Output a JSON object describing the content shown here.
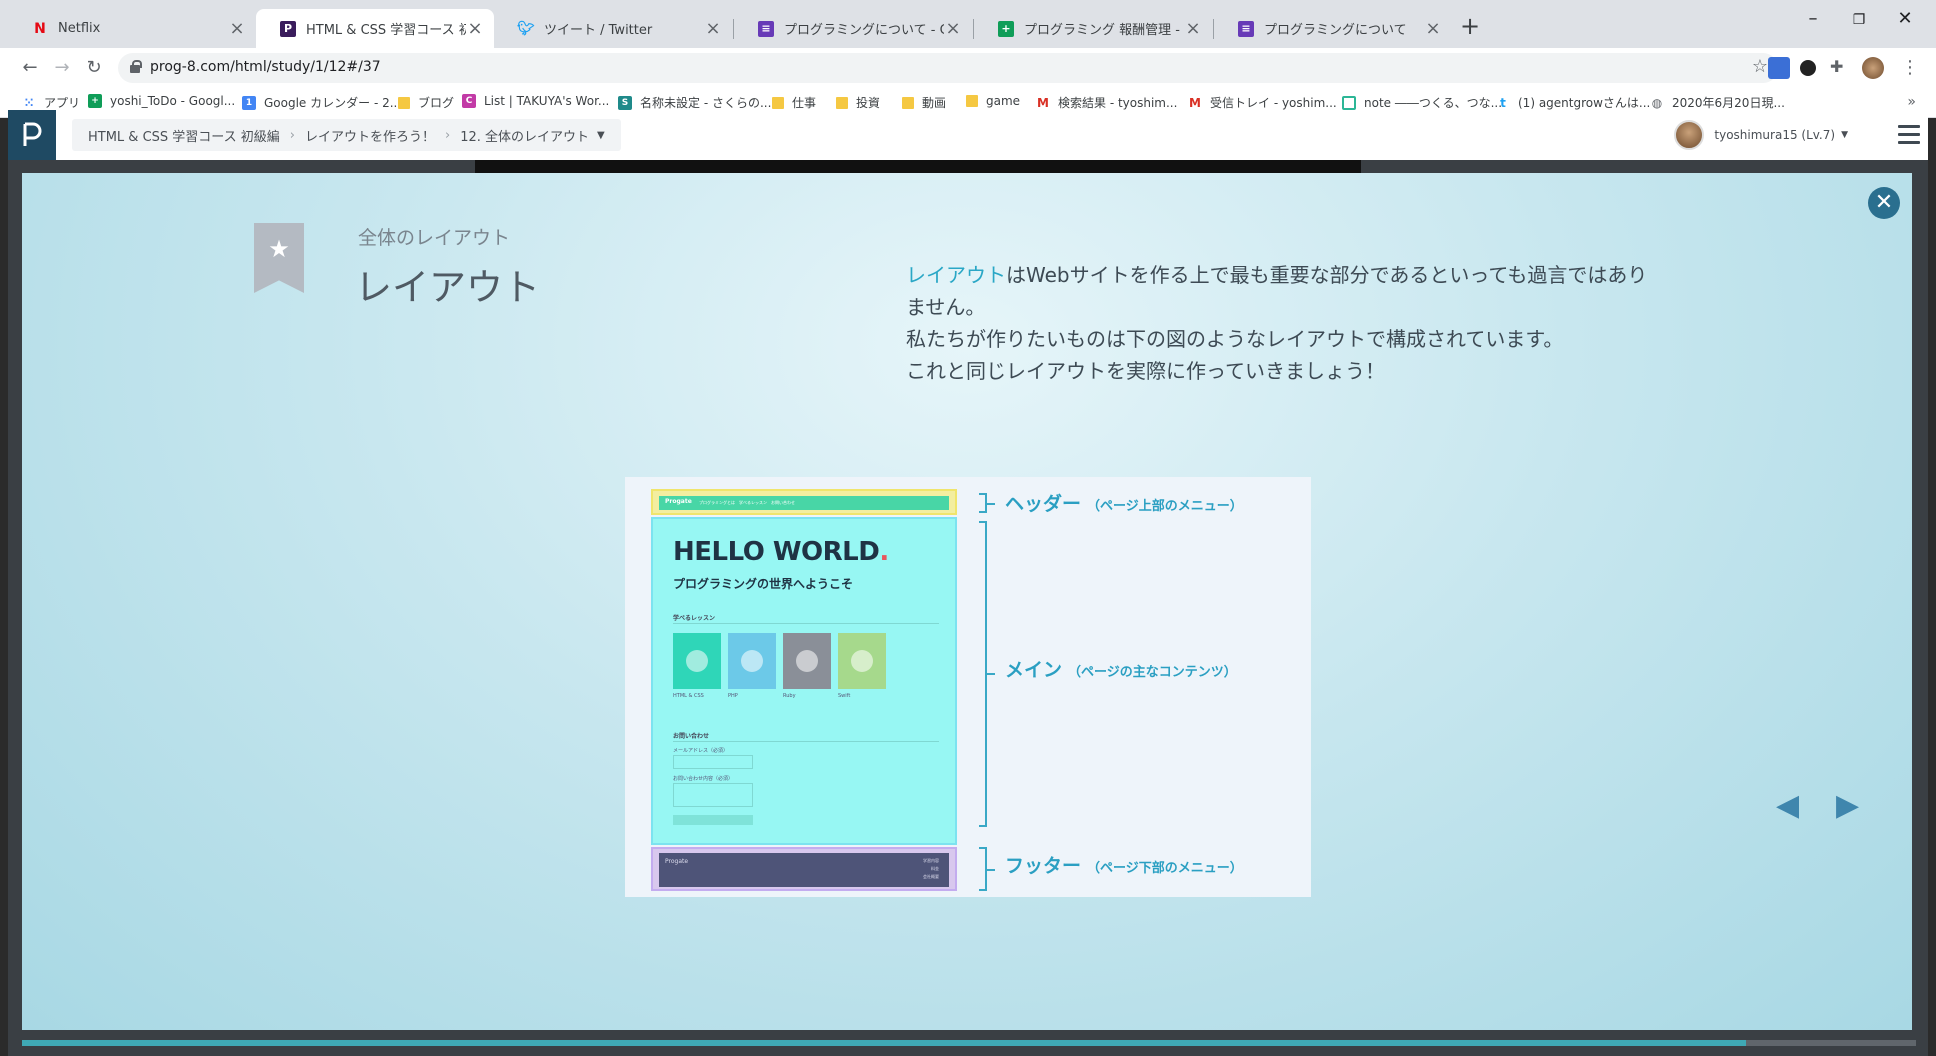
{
  "browser": {
    "tabs": [
      {
        "title": "Netflix",
        "fav": "N",
        "fav_color": "#e50914",
        "active": false
      },
      {
        "title": "HTML & CSS 学習コース 初級編 | ",
        "fav": "P",
        "fav_color": "#3a1c5c",
        "active": true
      },
      {
        "title": "ツイート / Twitter",
        "fav": "t",
        "fav_color": "#1da1f2",
        "active": false
      },
      {
        "title": "プログラミングについて - Google フォ",
        "fav": "≡",
        "fav_color": "#673ab7",
        "active": false
      },
      {
        "title": "プログラミング 報酬管理 - Google ス",
        "fav": "+",
        "fav_color": "#0f9d58",
        "active": false
      },
      {
        "title": "プログラミングについて",
        "fav": "≡",
        "fav_color": "#673ab7",
        "active": false
      }
    ],
    "url": "prog-8.com/html/study/1/12#/37",
    "bookmarks": [
      {
        "label": "アプリ",
        "kind": "apps"
      },
      {
        "label": "yoshi_ToDo - Googl...",
        "kind": "sheet"
      },
      {
        "label": "Google カレンダー - 2...",
        "kind": "cal"
      },
      {
        "label": "ブログ",
        "kind": "folder"
      },
      {
        "label": "List | TAKUYA's Wor...",
        "kind": "site"
      },
      {
        "label": "名称未設定 - さくらの...",
        "kind": "sakura"
      },
      {
        "label": "仕事",
        "kind": "folder"
      },
      {
        "label": "投資",
        "kind": "folder"
      },
      {
        "label": "動画",
        "kind": "folder"
      },
      {
        "label": "game",
        "kind": "folder"
      },
      {
        "label": "検索結果 - tyoshim...",
        "kind": "gmail"
      },
      {
        "label": "受信トレイ - yoshim...",
        "kind": "gmail"
      },
      {
        "label": "note ――つくる、つな...",
        "kind": "note"
      },
      {
        "label": "(1) agentgrowさんは...",
        "kind": "twitter"
      },
      {
        "label": "2020年6月20日現...",
        "kind": "globe"
      }
    ]
  },
  "header": {
    "breadcrumbs": [
      "HTML & CSS 学習コース 初級編",
      "レイアウトを作ろう！",
      "12. 全体のレイアウト"
    ],
    "username": "tyoshimura15 (Lv.7)"
  },
  "slide": {
    "subtitle": "全体のレイアウト",
    "title": "レイアウト",
    "desc_highlight": "レイアウト",
    "desc_line1": "はWebサイトを作る上で最も重要な部分であるといっても過言ではありません。",
    "desc_line2": "私たちが作りたいものは下の図のようなレイアウトで構成されています。",
    "desc_line3": "これと同じレイアウトを実際に作っていきましょう！",
    "diagram": {
      "mock_brand": "Progate",
      "mock_nav": "プログラミングとは　学べるレッスン　お問い合わせ",
      "hello": "HELLO WORLD",
      "hello_dot": ".",
      "welcome": "プログラミングの世界へようこそ",
      "lessons_heading": "学べるレッスン",
      "lessons": [
        {
          "name": "HTML & CSS",
          "color": "#2fd6b8"
        },
        {
          "name": "PHP",
          "color": "#6cc9e8"
        },
        {
          "name": "Ruby",
          "color": "#8a8f98"
        },
        {
          "name": "Swift",
          "color": "#a6d98c"
        }
      ],
      "contact_heading": "お問い合わせ",
      "contact_labels": [
        "メールアドレス（必須）",
        "お問い合わせ内容（必須）"
      ],
      "footer_brand": "Progate",
      "footer_links": [
        "学習内容",
        "料金",
        "会社概要"
      ],
      "labels": [
        {
          "name": "ヘッダー",
          "note": "（ページ上部のメニュー）"
        },
        {
          "name": "メイン",
          "note": "（ページの主なコンテンツ）"
        },
        {
          "name": "フッター",
          "note": "（ページ下部のメニュー）"
        }
      ]
    }
  }
}
